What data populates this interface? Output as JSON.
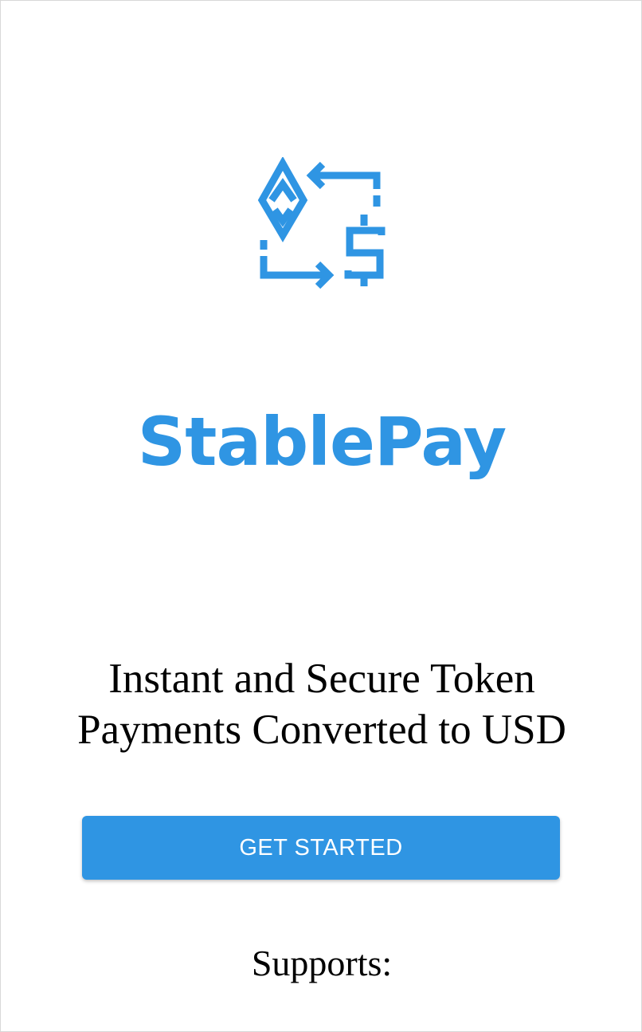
{
  "app": {
    "name": "StablePay",
    "brand_color": "#2f95e3"
  },
  "hero": {
    "icon": "eth-to-dollar-exchange-icon",
    "brand_text": "StablePay",
    "tagline": "Instant and Secure Token Payments Converted to USD"
  },
  "actions": {
    "get_started_label": "GET STARTED"
  },
  "footer": {
    "supports_label": "Supports:"
  }
}
